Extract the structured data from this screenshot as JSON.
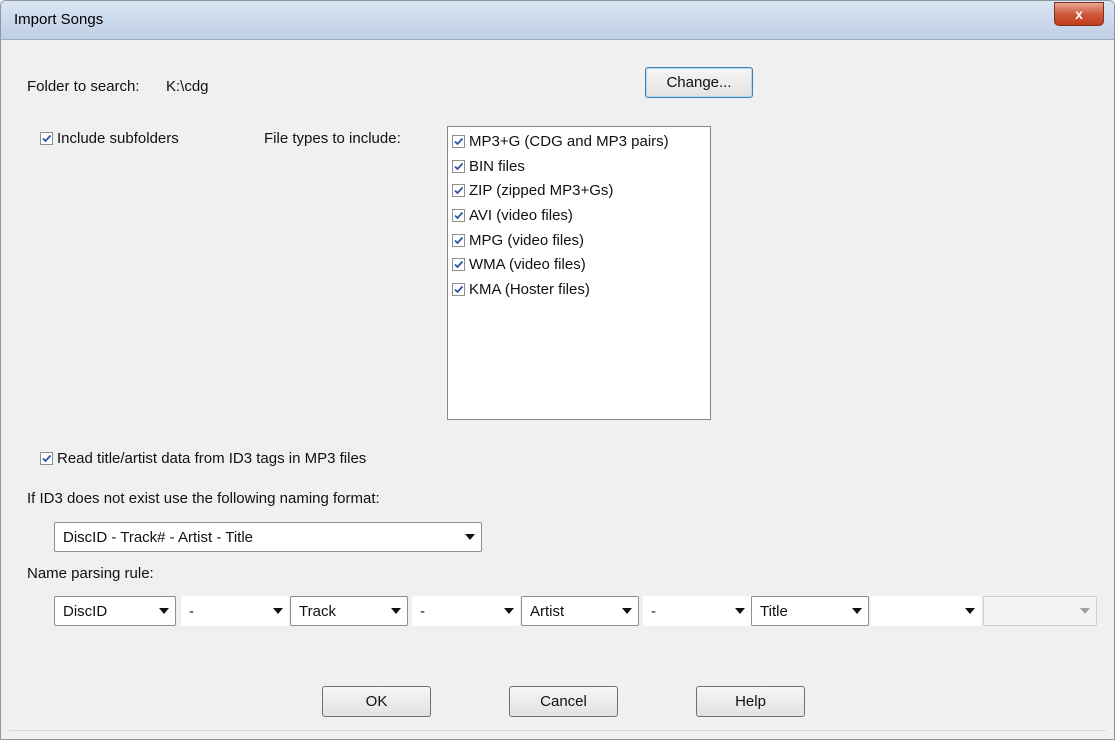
{
  "window": {
    "title": "Import Songs",
    "close_label": "x"
  },
  "folder": {
    "label": "Folder to search:",
    "value": "K:\\cdg",
    "change_label": "Change..."
  },
  "include_subfolders": {
    "label": "Include subfolders",
    "checked": true
  },
  "file_types": {
    "label": "File types to include:",
    "items": [
      {
        "label": "MP3+G (CDG and MP3 pairs)",
        "checked": true
      },
      {
        "label": "BIN files",
        "checked": true
      },
      {
        "label": "ZIP (zipped MP3+Gs)",
        "checked": true
      },
      {
        "label": "AVI (video files)",
        "checked": true
      },
      {
        "label": "MPG (video files)",
        "checked": true
      },
      {
        "label": "WMA (video files)",
        "checked": true
      },
      {
        "label": "KMA (Hoster files)",
        "checked": true
      }
    ]
  },
  "read_id3": {
    "label": "Read title/artist data from ID3 tags in MP3 files",
    "checked": true
  },
  "naming_format": {
    "label": "If ID3 does not exist use the following naming format:",
    "value": "DiscID - Track# - Artist - Title"
  },
  "parsing_rule": {
    "label": "Name parsing rule:",
    "fields": [
      "DiscID",
      "-",
      "Track",
      "-",
      "Artist",
      "-",
      "Title",
      "",
      ""
    ]
  },
  "buttons": {
    "ok": "OK",
    "cancel": "Cancel",
    "help": "Help"
  }
}
